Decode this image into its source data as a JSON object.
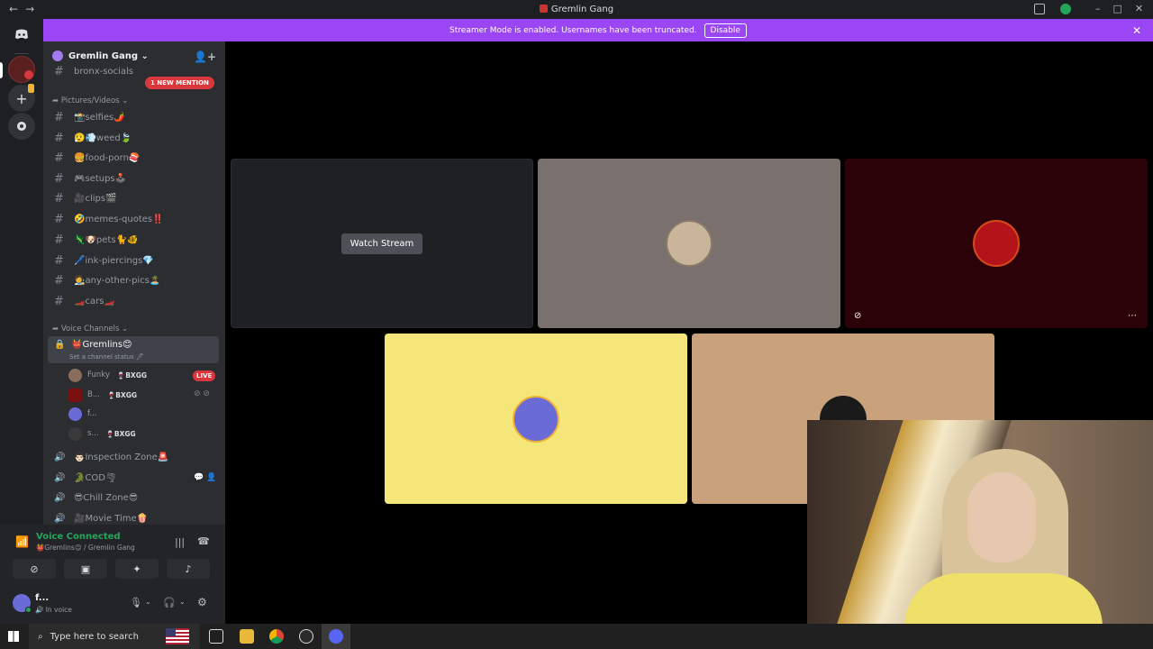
{
  "window": {
    "title": "Gremlin Gang",
    "back": "←",
    "forward": "→",
    "minimize": "–",
    "maximize": "□",
    "close": "✕"
  },
  "banner": {
    "text": "Streamer Mode is enabled. Usernames have been truncated.",
    "disable": "Disable",
    "close": "✕"
  },
  "guild": {
    "name": "Gremlin Gang ⌄"
  },
  "channels": {
    "partial_top": "bronx-socials",
    "mention_pill": "1 NEW MENTION",
    "category_pictures": "➦ Pictures/Videos ⌄",
    "text": [
      {
        "name": "📸selfies🌶️"
      },
      {
        "name": "😮‍💨💨weed🍃"
      },
      {
        "name": "🍔food-porn🍣"
      },
      {
        "name": "🎮setups🕹️"
      },
      {
        "name": "🎥clips🎬"
      },
      {
        "name": "🤣memes-quotes‼️"
      },
      {
        "name": "🦎🐶pets🐈🐠"
      },
      {
        "name": "🖊️ink-piercings💎"
      },
      {
        "name": "🧑‍🎨any-other-pics🏝️"
      },
      {
        "name": "🏎️cars🏎️"
      }
    ],
    "category_voice": "➦ Voice Channels ⌄",
    "active_voice": {
      "name": "👹Gremlins😊",
      "status": "Set a channel status 🖊"
    },
    "voice_users": [
      {
        "name": "Funky",
        "tag": "BXGG",
        "live": "LIVE"
      },
      {
        "name": "B...",
        "tag": "BXGG"
      },
      {
        "name": "f..."
      },
      {
        "name": "s...",
        "tag": "BXGG"
      }
    ],
    "voice": [
      {
        "name": "👨🏻Inspection Zone🚨"
      },
      {
        "name": "🐊COD🌪"
      },
      {
        "name": "😎Chill Zone😎"
      },
      {
        "name": "🎥Movie Time🍿"
      }
    ]
  },
  "voicepanel": {
    "connected": "Voice Connected",
    "location": "👹Gremlins😊 / Gremlin Gang"
  },
  "userbar": {
    "name": "f...",
    "status": "🔊 In voice"
  },
  "stage": {
    "watch": "Watch Stream"
  },
  "taskbar": {
    "search_placeholder": "Type here to search"
  },
  "colors": {
    "accent": "#9b46f5",
    "live": "#da373c",
    "connected": "#23a55a",
    "tile_gray": "#7a716e",
    "tile_maroon": "#2b0207",
    "tile_yellow": "#f5e67a",
    "tile_tan": "#c9a27b"
  }
}
